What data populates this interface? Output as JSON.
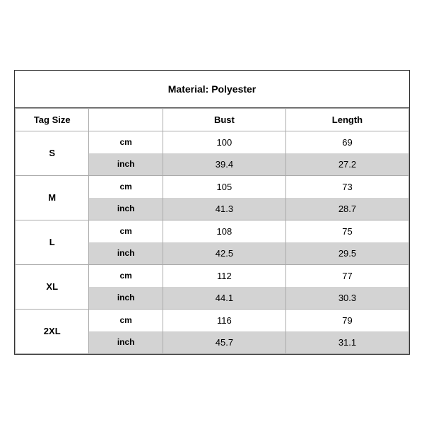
{
  "title": "Material: Polyester",
  "headers": {
    "tag_size": "Tag Size",
    "bust": "Bust",
    "length": "Length"
  },
  "sizes": [
    {
      "label": "S",
      "cm": {
        "bust": "100",
        "length": "69"
      },
      "inch": {
        "bust": "39.4",
        "length": "27.2"
      }
    },
    {
      "label": "M",
      "cm": {
        "bust": "105",
        "length": "73"
      },
      "inch": {
        "bust": "41.3",
        "length": "28.7"
      }
    },
    {
      "label": "L",
      "cm": {
        "bust": "108",
        "length": "75"
      },
      "inch": {
        "bust": "42.5",
        "length": "29.5"
      }
    },
    {
      "label": "XL",
      "cm": {
        "bust": "112",
        "length": "77"
      },
      "inch": {
        "bust": "44.1",
        "length": "30.3"
      }
    },
    {
      "label": "2XL",
      "cm": {
        "bust": "116",
        "length": "79"
      },
      "inch": {
        "bust": "45.7",
        "length": "31.1"
      }
    }
  ],
  "unit_cm": "cm",
  "unit_inch": "inch"
}
